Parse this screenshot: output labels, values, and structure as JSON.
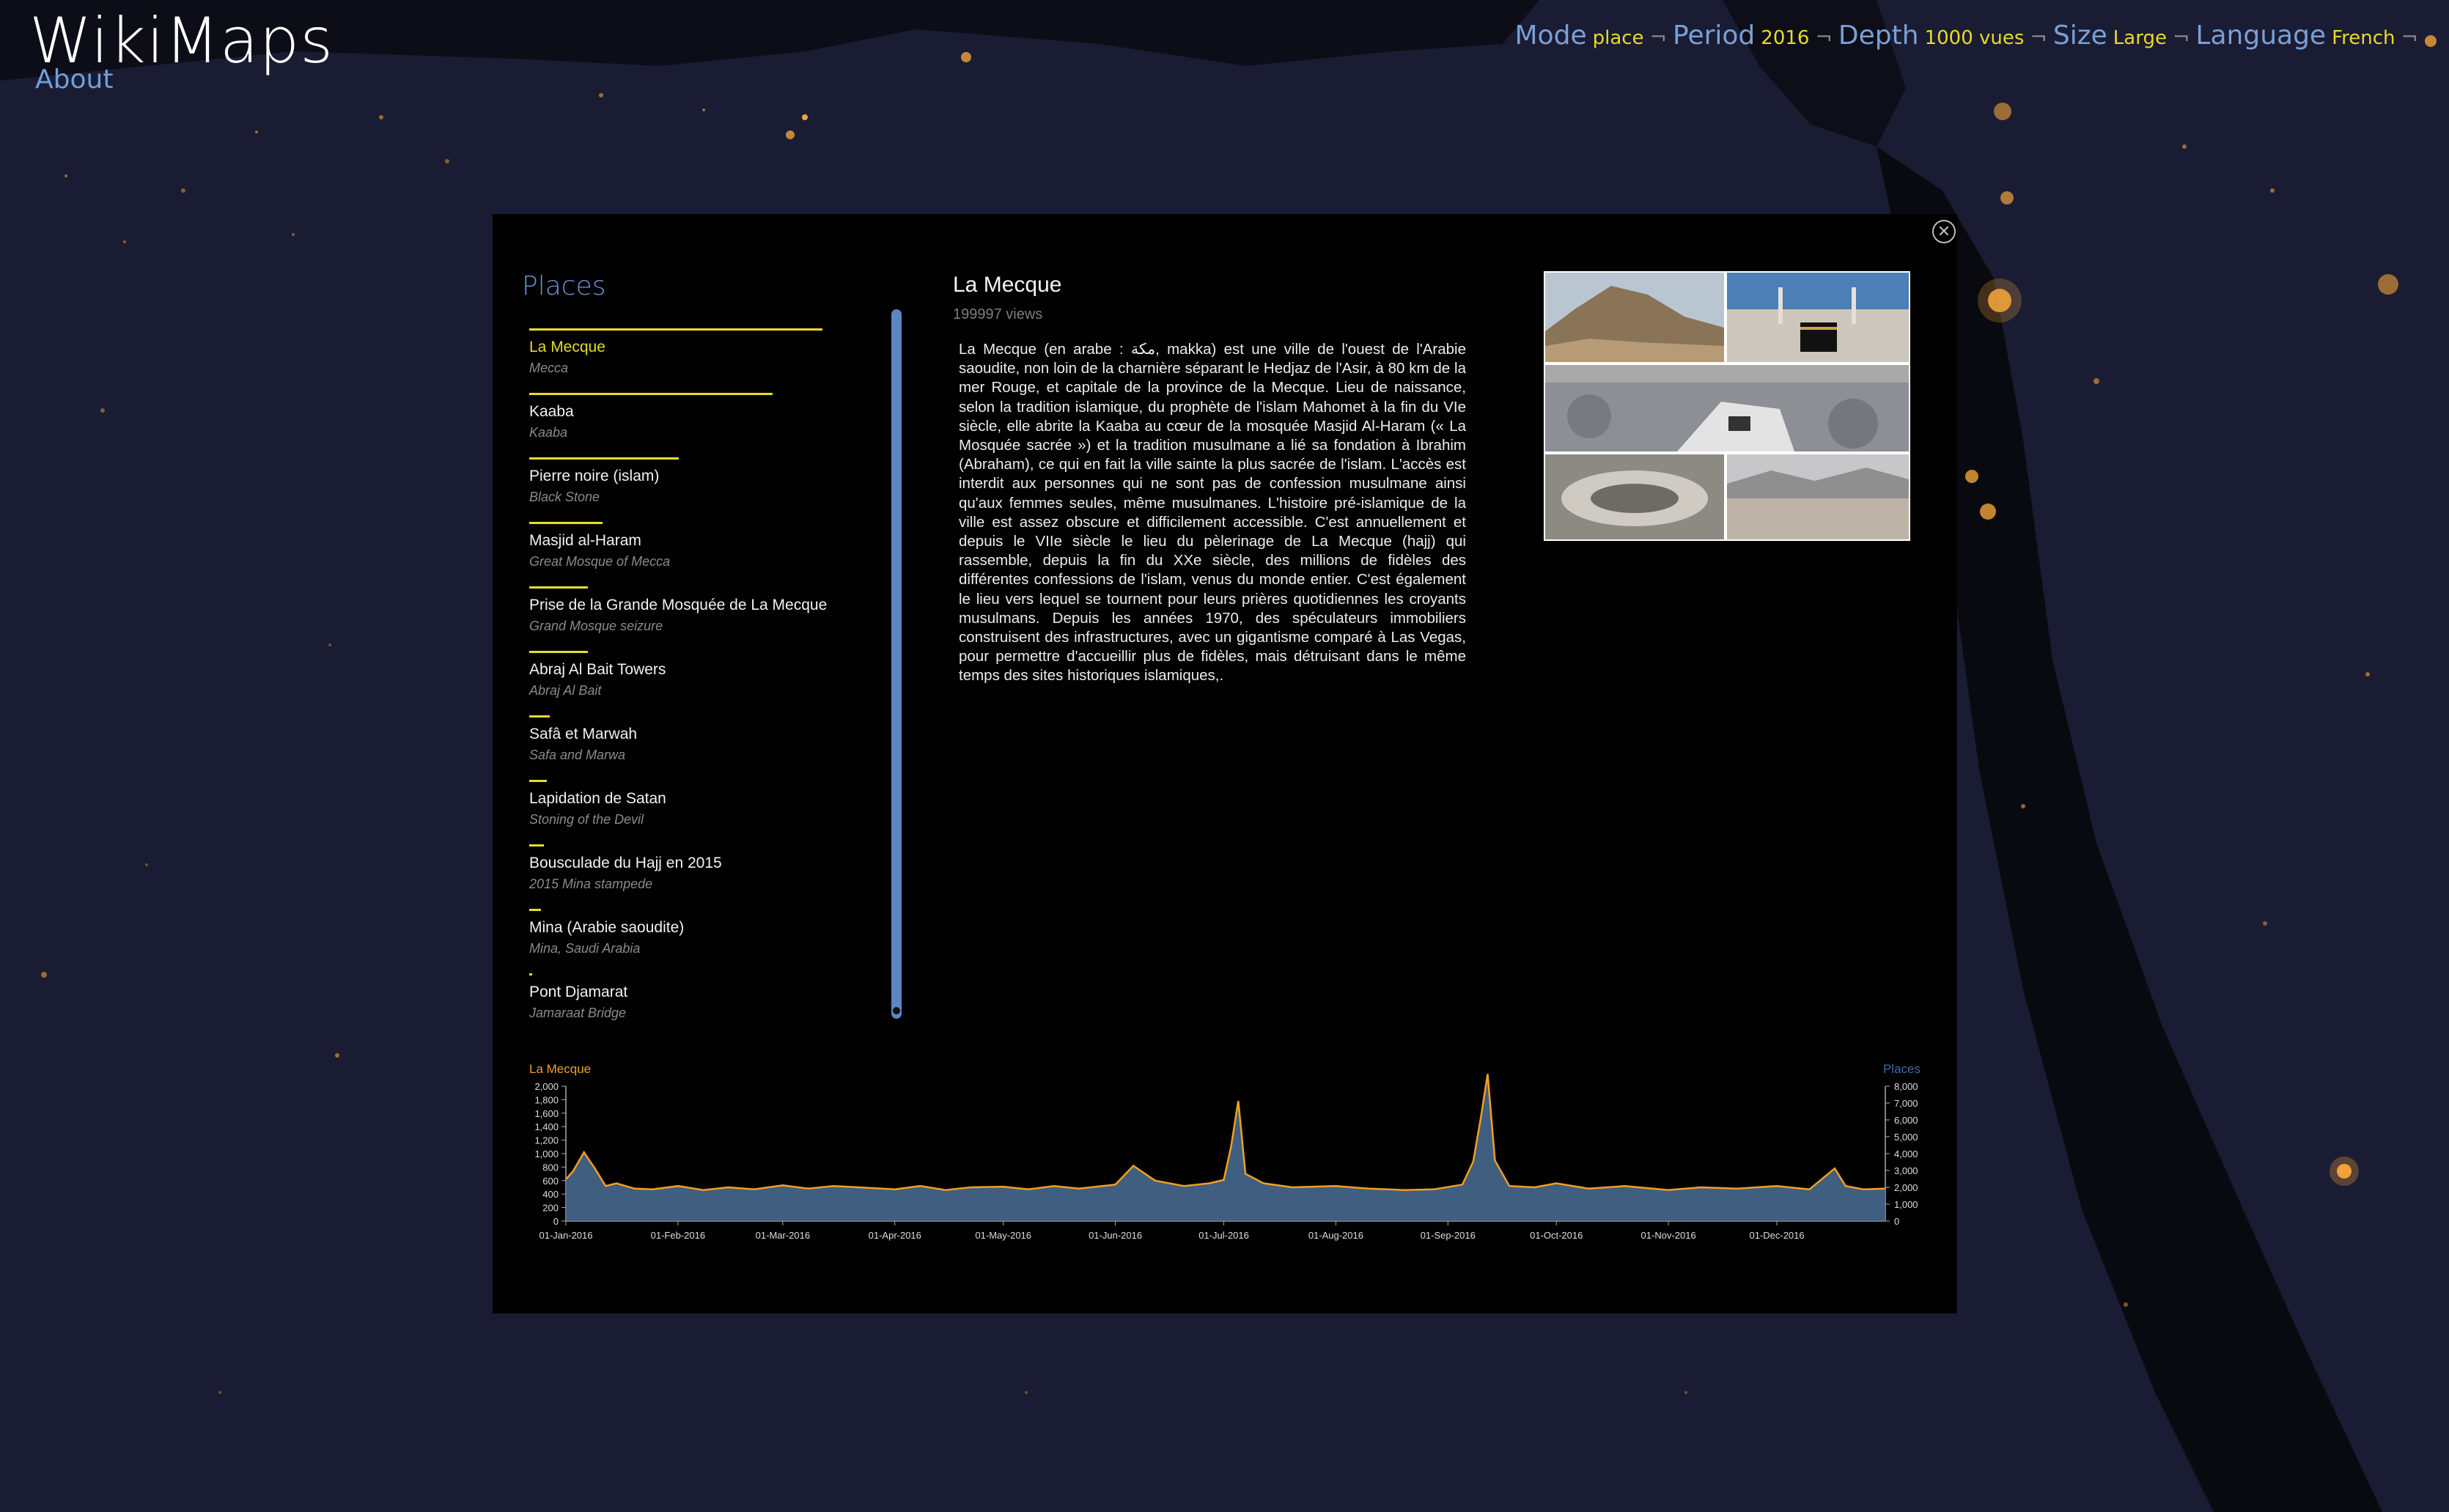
{
  "header": {
    "app_title": "WikiMaps",
    "about_label": "About",
    "nav": [
      {
        "label": "Mode",
        "value": "place"
      },
      {
        "label": "Period",
        "value": "2016"
      },
      {
        "label": "Depth",
        "value": "1000 vues"
      },
      {
        "label": "Size",
        "value": "Large"
      },
      {
        "label": "Language",
        "value": "French"
      }
    ],
    "separator": "¬"
  },
  "panel": {
    "close_icon": "close-circle-icon",
    "places_heading": "Places",
    "places": [
      {
        "name": "La Mecque",
        "sub": "Mecca",
        "bar_fraction": 1.0,
        "selected": true
      },
      {
        "name": "Kaaba",
        "sub": "Kaaba",
        "bar_fraction": 0.83
      },
      {
        "name": "Pierre noire (islam)",
        "sub": "Black Stone",
        "bar_fraction": 0.51
      },
      {
        "name": "Masjid al-Haram",
        "sub": "Great Mosque of Mecca",
        "bar_fraction": 0.25
      },
      {
        "name": "Prise de la Grande Mosquée de La Mecque",
        "sub": "Grand Mosque seizure",
        "bar_fraction": 0.2
      },
      {
        "name": "Abraj Al Bait Towers",
        "sub": "Abraj Al Bait",
        "bar_fraction": 0.2
      },
      {
        "name": "Safâ et Marwah",
        "sub": "Safa and Marwa",
        "bar_fraction": 0.07
      },
      {
        "name": "Lapidation de Satan",
        "sub": "Stoning of the Devil",
        "bar_fraction": 0.06
      },
      {
        "name": "Bousculade du Hajj en 2015",
        "sub": "2015 Mina stampede",
        "bar_fraction": 0.05
      },
      {
        "name": "Mina (Arabie saoudite)",
        "sub": "Mina, Saudi Arabia",
        "bar_fraction": 0.04
      },
      {
        "name": "Pont Djamarat",
        "sub": "Jamaraat Bridge",
        "bar_fraction": 0.01
      }
    ],
    "article": {
      "title": "La Mecque",
      "views": "199997 views",
      "text": "La Mecque (en arabe : مكة, makka) est une ville de l'ouest de l'Arabie saoudite, non loin de la charnière séparant le Hedjaz de l'Asir, à 80 km de la mer Rouge, et capitale de la province de la Mecque. Lieu de naissance, selon la tradition islamique, du prophète de l'islam Mahomet à la fin du VIe siècle, elle abrite la Kaaba au cœur de la mosquée Masjid Al-Haram (« La Mosquée sacrée ») et la tradition musulmane a lié sa fondation à Ibrahim (Abraham), ce qui en fait la ville sainte la plus sacrée de l'islam. L'accès est interdit aux personnes qui ne sont pas de confession musulmane ainsi qu'aux femmes seules, même musulmanes. L'histoire pré-islamique de la ville est assez obscure et difficilement accessible. C'est annuellement et depuis le VIIe siècle le lieu du pèlerinage de La Mecque (hajj) qui rassemble, depuis la fin du XXe siècle, des millions de fidèles des différentes confessions de l'islam, venus du monde entier. C'est également le lieu vers lequel se tournent pour leurs prières quotidiennes les croyants musulmans. Depuis les années 1970, des spéculateurs immobiliers construisent des infrastructures, avec un gigantisme comparé à Las Vegas, pour permettre d'accueillir plus de fidèles, mais détruisant dans le même temps des sites historiques islamiques,."
    }
  },
  "colors": {
    "accent_yellow": "#e4de2a",
    "link_blue": "#6f9fd9",
    "series_orange": "#f0a021",
    "area_blue": "#4a6f96"
  },
  "chart_data": {
    "type": "line",
    "left_series_label": "La Mecque",
    "right_series_label": "Places",
    "left_ticks": [
      "0",
      "200",
      "400",
      "600",
      "800",
      "1,000",
      "1,200",
      "1,400",
      "1,600",
      "1,800",
      "2,000"
    ],
    "right_ticks": [
      "0",
      "1,000",
      "2,000",
      "3,000",
      "4,000",
      "5,000",
      "6,000",
      "7,000",
      "8,000"
    ],
    "left_ylim": [
      0,
      2000
    ],
    "right_ylim": [
      0,
      8000
    ],
    "x_ticks": [
      "01-Jan-2016",
      "01-Feb-2016",
      "01-Mar-2016",
      "01-Apr-2016",
      "01-May-2016",
      "01-Jun-2016",
      "01-Jul-2016",
      "01-Aug-2016",
      "01-Sep-2016",
      "01-Oct-2016",
      "01-Nov-2016",
      "01-Dec-2016"
    ],
    "series": [
      {
        "name": "La Mecque",
        "x": [
          "2016-01-01",
          "2016-01-03",
          "2016-01-06",
          "2016-01-09",
          "2016-01-12",
          "2016-01-15",
          "2016-01-20",
          "2016-01-25",
          "2016-02-01",
          "2016-02-08",
          "2016-02-15",
          "2016-02-22",
          "2016-03-01",
          "2016-03-08",
          "2016-03-15",
          "2016-03-22",
          "2016-04-01",
          "2016-04-08",
          "2016-04-15",
          "2016-04-22",
          "2016-05-01",
          "2016-05-08",
          "2016-05-15",
          "2016-05-22",
          "2016-06-01",
          "2016-06-06",
          "2016-06-12",
          "2016-06-20",
          "2016-06-27",
          "2016-07-01",
          "2016-07-03",
          "2016-07-05",
          "2016-07-07",
          "2016-07-12",
          "2016-07-20",
          "2016-08-01",
          "2016-08-10",
          "2016-08-20",
          "2016-08-28",
          "2016-09-05",
          "2016-09-08",
          "2016-09-10",
          "2016-09-12",
          "2016-09-14",
          "2016-09-18",
          "2016-09-25",
          "2016-10-01",
          "2016-10-10",
          "2016-10-20",
          "2016-11-01",
          "2016-11-10",
          "2016-11-20",
          "2016-12-01",
          "2016-12-10",
          "2016-12-17",
          "2016-12-20",
          "2016-12-25",
          "2016-12-31"
        ],
        "values": [
          620,
          740,
          1020,
          780,
          520,
          560,
          480,
          470,
          520,
          460,
          500,
          470,
          530,
          480,
          520,
          500,
          470,
          520,
          460,
          500,
          510,
          470,
          520,
          480,
          540,
          820,
          600,
          520,
          560,
          610,
          1100,
          1780,
          700,
          560,
          500,
          520,
          480,
          460,
          470,
          540,
          880,
          1500,
          2180,
          900,
          520,
          500,
          560,
          480,
          520,
          460,
          500,
          480,
          520,
          470,
          780,
          520,
          470,
          480
        ]
      }
    ]
  }
}
